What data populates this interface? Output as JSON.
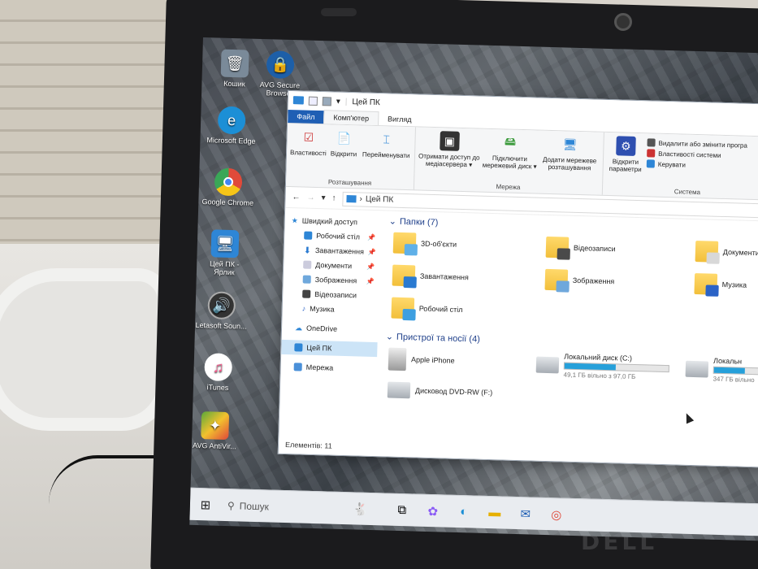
{
  "desktop": {
    "icons": [
      {
        "label": "Кошик",
        "icon": "recycle-bin-icon",
        "color": "#7a8a99"
      },
      {
        "label": "AVG Secure Browser",
        "icon": "avg-browser-icon",
        "color": "#1d5fa8"
      },
      {
        "label": "Microsoft Edge",
        "icon": "edge-icon",
        "color": "#1c8fd6"
      },
      {
        "label": "Google Chrome",
        "icon": "chrome-icon",
        "color": "#e04a3a"
      },
      {
        "label": "Цей ПК - Ярлик",
        "icon": "this-pc-shortcut-icon",
        "color": "#2e86d6"
      },
      {
        "label": "Letasoft Soun...",
        "icon": "speaker-icon",
        "color": "#333333"
      },
      {
        "label": "iTunes",
        "icon": "itunes-icon",
        "color": "#f25b8c"
      },
      {
        "label": "AVG AntiVir...",
        "icon": "avg-antivirus-icon",
        "color": "#5aa83a"
      }
    ]
  },
  "window": {
    "title": "Цей ПК",
    "tabs": [
      "Файл",
      "Комп'ютер",
      "Вигляд"
    ],
    "ribbon": {
      "location": {
        "label": "Розташування",
        "buttons": [
          "Властивості",
          "Відкрити",
          "Перейменувати"
        ]
      },
      "network": {
        "label": "Мережа",
        "buttons": [
          "Отримати доступ до медіасервера ▾",
          "Підключити мережевий диск ▾",
          "Додати мережеве розташування"
        ]
      },
      "system": {
        "label": "Система",
        "open_settings": "Відкрити параметри",
        "links": [
          "Видалити або змінити програ",
          "Властивості системи",
          "Керувати"
        ]
      }
    },
    "address": {
      "path": "Цей ПК"
    },
    "nav": {
      "quick_access": "Швидкий доступ",
      "quick_items": [
        "Робочий стіл",
        "Завантаження",
        "Документи",
        "Зображення",
        "Відеозаписи",
        "Музика"
      ],
      "onedrive": "OneDrive",
      "this_pc": "Цей ПК",
      "network": "Мережа"
    },
    "folders_header": "Папки (7)",
    "folders": [
      {
        "name": "3D-об'єкти",
        "overlay": "#5fb0e8"
      },
      {
        "name": "Завантаження",
        "overlay": "#2a7ad1"
      },
      {
        "name": "Робочий стіл",
        "overlay": "#3d9fe0"
      },
      {
        "name": "Відеозаписи",
        "overlay": "#4a4a4a"
      },
      {
        "name": "Зображення",
        "overlay": "#6fa8dc"
      },
      {
        "name": "Документи",
        "overlay": "#d8d8d8"
      },
      {
        "name": "Музика",
        "overlay": "#2b63c6"
      }
    ],
    "devices_header": "Пристрої та носії (4)",
    "devices": [
      {
        "name": "Apple iPhone",
        "sub": ""
      },
      {
        "name": "Дисковод DVD-RW (F:)",
        "sub": ""
      },
      {
        "name": "Локальний диск (C:)",
        "sub": "49,1 ГБ вільно з 97,0 ГБ",
        "used": 0.49
      },
      {
        "name": "Локальн",
        "sub": "347 ГБ вільно",
        "used": 0.3
      }
    ],
    "status": "Елементів: 11"
  },
  "taskbar": {
    "search_placeholder": "Пошук"
  },
  "hardware": {
    "brand": "DELL"
  }
}
